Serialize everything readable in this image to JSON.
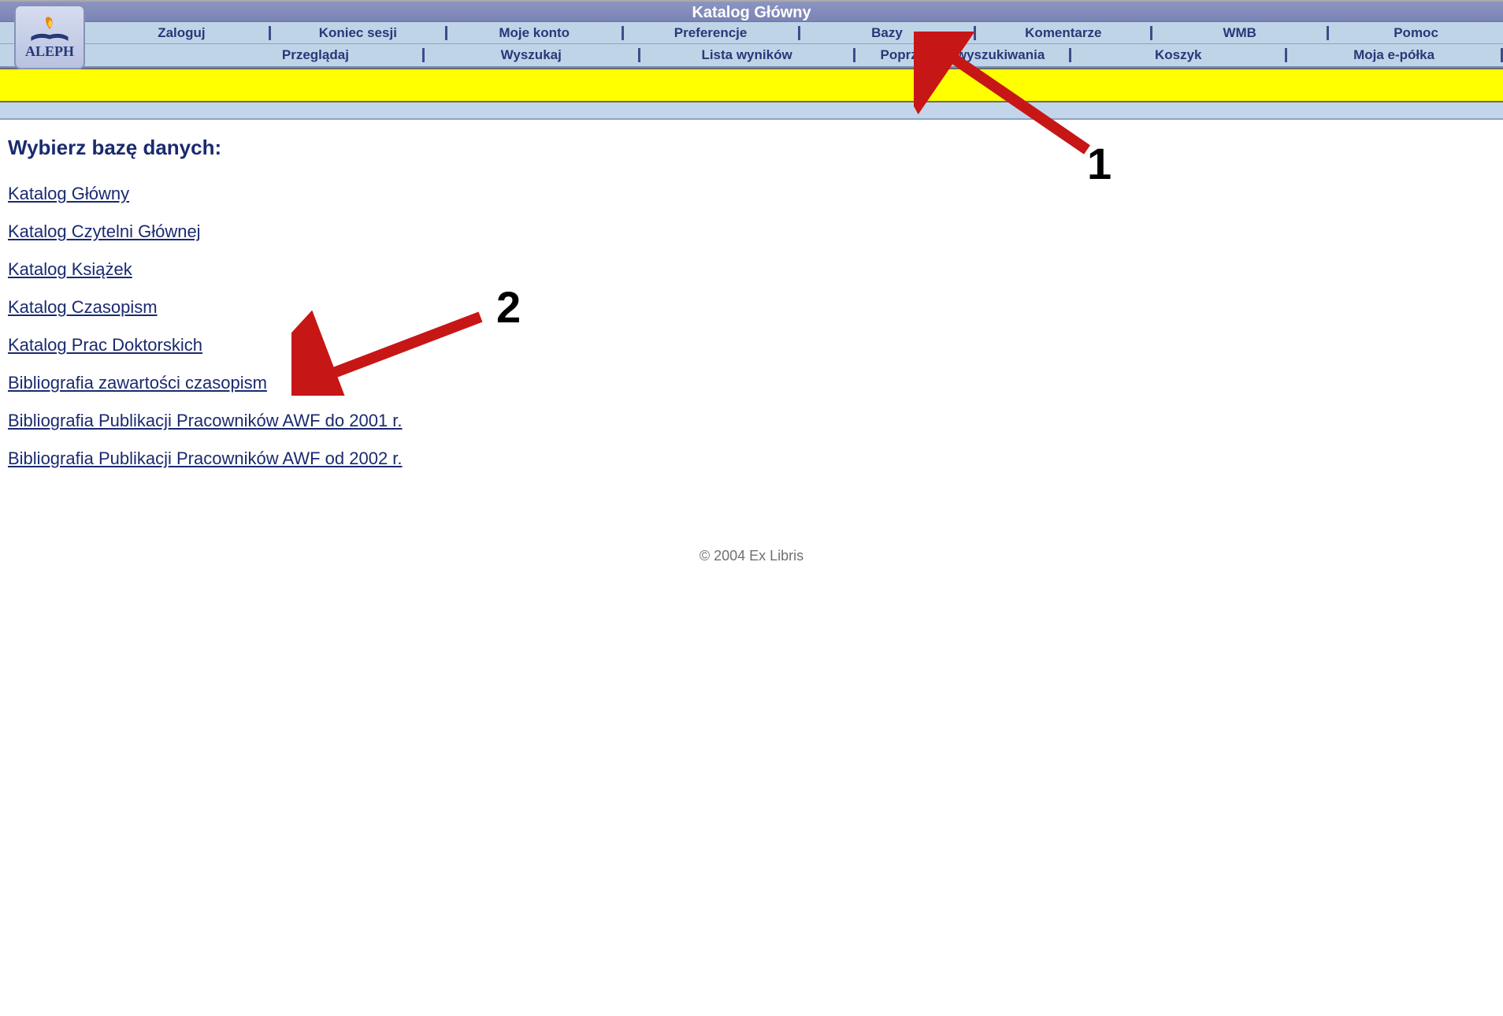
{
  "header": {
    "title": "Katalog Główny",
    "logo_text": "ALEPH"
  },
  "nav_row1": [
    "Zaloguj",
    "Koniec sesji",
    "Moje konto",
    "Preferencje",
    "Bazy",
    "Komentarze",
    "WMB",
    "Pomoc"
  ],
  "nav_row2": [
    "Przeglądaj",
    "Wyszukaj",
    "Lista wyników",
    "Poprzednie wyszukiwania",
    "Koszyk",
    "Moja e-półka"
  ],
  "content": {
    "heading": "Wybierz bazę danych:",
    "databases": [
      "Katalog Główny",
      "Katalog Czytelni Głównej",
      "Katalog Książek",
      "Katalog Czasopism",
      "Katalog Prac Doktorskich",
      "Bibliografia zawartości czasopism",
      "Bibliografia Publikacji Pracowników AWF do 2001 r.",
      "Bibliografia Publikacji Pracowników AWF od 2002 r."
    ]
  },
  "footer": "© 2004 Ex Libris",
  "annotations": {
    "label1": "1",
    "label2": "2"
  }
}
